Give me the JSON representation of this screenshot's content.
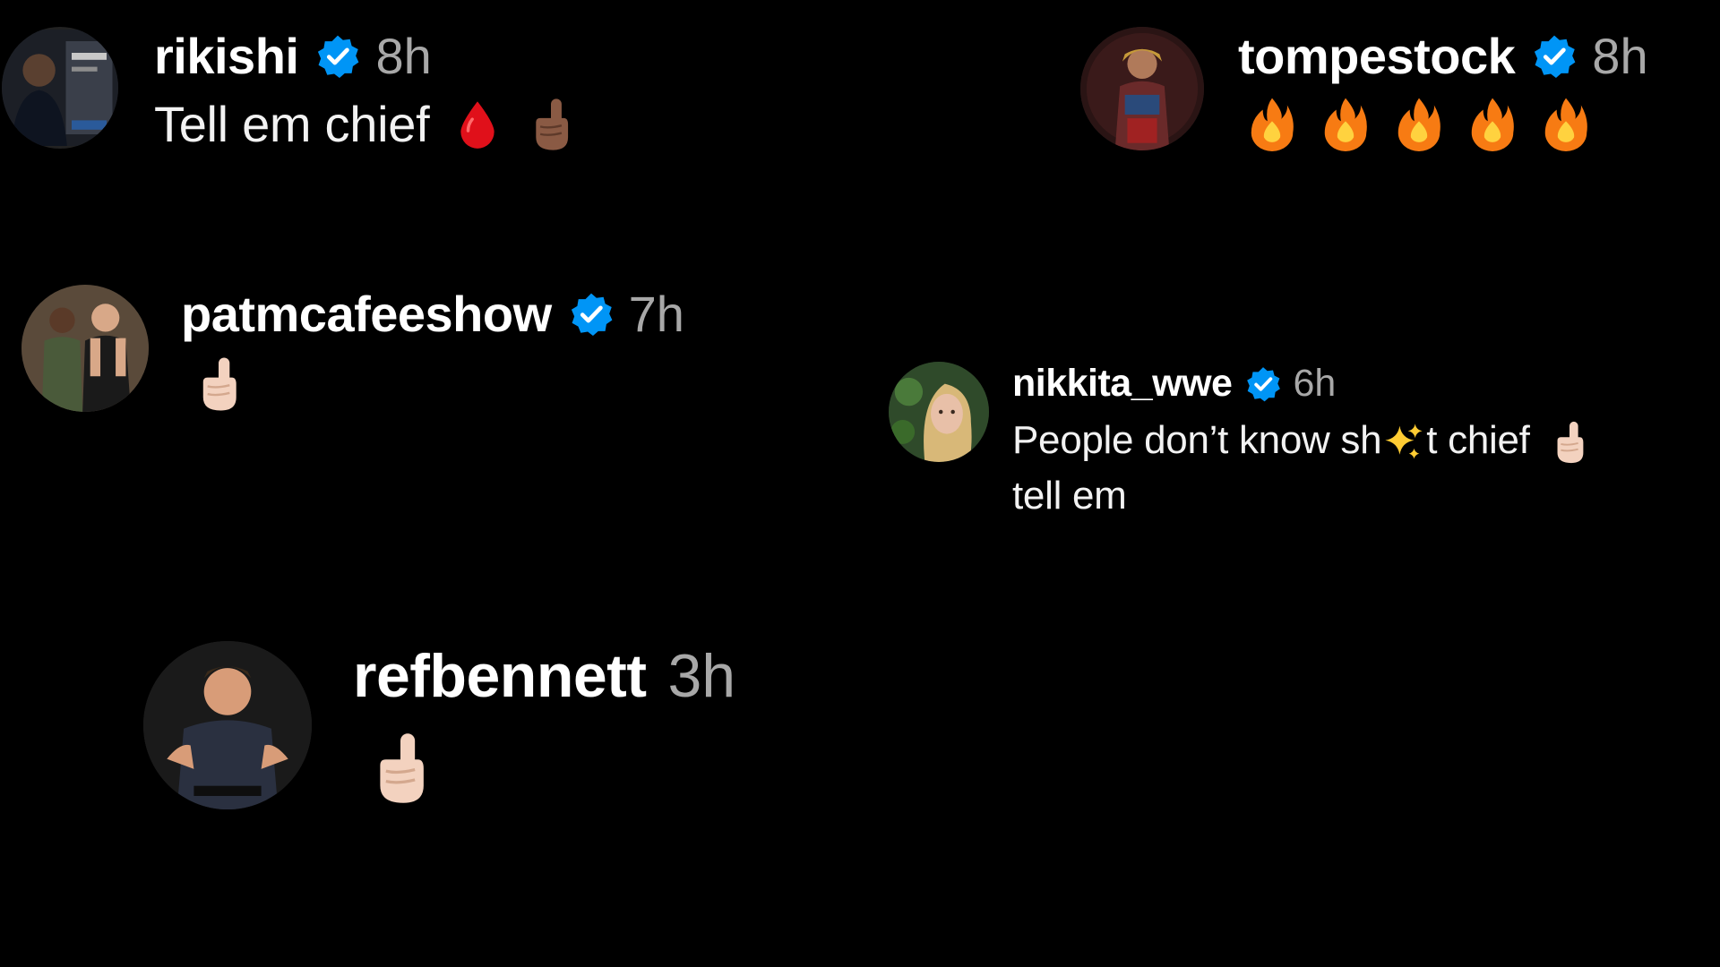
{
  "colors": {
    "background": "#000000",
    "username": "#ffffff",
    "timestamp": "#a8a8a8",
    "verified_badge": "#0095f6"
  },
  "comments": [
    {
      "username": "rikishi",
      "verified": true,
      "time": "8h",
      "text": "Tell em chief",
      "emojis": [
        "drop-of-blood",
        "index-pointing-up-medium-dark"
      ]
    },
    {
      "username": "tompestock",
      "verified": true,
      "time": "8h",
      "text": "",
      "emojis": [
        "fire",
        "fire",
        "fire",
        "fire",
        "fire"
      ]
    },
    {
      "username": "patmcafeeshow",
      "verified": true,
      "time": "7h",
      "text": "",
      "emojis": [
        "index-pointing-up-light"
      ]
    },
    {
      "username": "nikkita_wwe",
      "verified": true,
      "time": "6h",
      "text_part1": "People don’t know sh",
      "text_part2": "t chief",
      "text_part3": "tell em",
      "emojis": [
        "sparkles",
        "index-pointing-up-light"
      ]
    },
    {
      "username": "refbennett",
      "verified": false,
      "time": "3h",
      "text": "",
      "emojis": [
        "index-pointing-up-light"
      ]
    }
  ]
}
